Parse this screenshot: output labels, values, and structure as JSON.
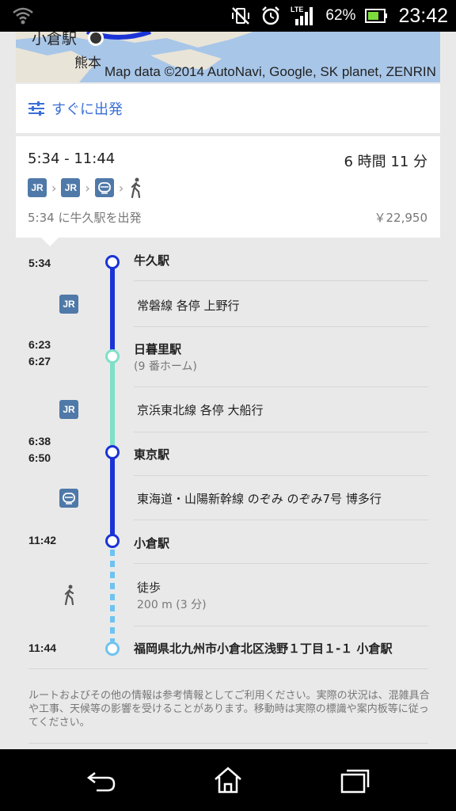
{
  "status_bar": {
    "battery_percent": "62%",
    "time": "23:42",
    "network": "LTE"
  },
  "map": {
    "city_label_1": "小倉駅",
    "city_label_2": "熊本",
    "attribution": "Map data ©2014 AutoNavi, Google, SK planet, ZENRIN"
  },
  "depart_option": {
    "label": "すぐに出発"
  },
  "summary": {
    "time_range": "5:34 - 11:44",
    "duration": "6 時間 11 分",
    "depart_text": "5:34 に牛久駅を出発",
    "fare": "￥22,950",
    "transit_icons": [
      "jr-icon",
      "jr-icon",
      "shinkansen-icon",
      "walk-icon"
    ]
  },
  "timeline": {
    "stops": [
      {
        "time": "5:34",
        "name": "牛久駅"
      },
      {
        "time_arr": "6:23",
        "time_dep": "6:27",
        "name": "日暮里駅",
        "note": "(9 番ホーム)"
      },
      {
        "time_arr": "6:38",
        "time_dep": "6:50",
        "name": "東京駅"
      },
      {
        "time": "11:42",
        "name": "小倉駅"
      },
      {
        "time": "11:44",
        "name": "福岡県北九州市小倉北区浅野１丁目１-１ 小倉駅"
      }
    ],
    "legs": [
      {
        "icon": "jr-icon",
        "line": "常磐線 各停 上野行"
      },
      {
        "icon": "jr-icon",
        "line": "京浜東北線 各停 大船行"
      },
      {
        "icon": "shinkansen-icon",
        "line": "東海道・山陽新幹線 のぞみ のぞみ7号 博多行"
      },
      {
        "icon": "walk-icon",
        "line": "徒歩",
        "detail": "200 m (3 分)"
      }
    ]
  },
  "disclaimer": "ルートおよびその他の情報は参考情報としてご利用ください。実際の状況は、混雑具合や工事、天候等の影響を受けることがあります。移動時は実際の標識や案内板等に従ってください。",
  "badges": {
    "jr": "JR"
  },
  "colors": {
    "accent": "#3a6fd8",
    "line_blue": "#1a33d6",
    "line_green": "#7fe0c8",
    "walk_blue": "#6ec3f0",
    "badge": "#4f79a8"
  }
}
